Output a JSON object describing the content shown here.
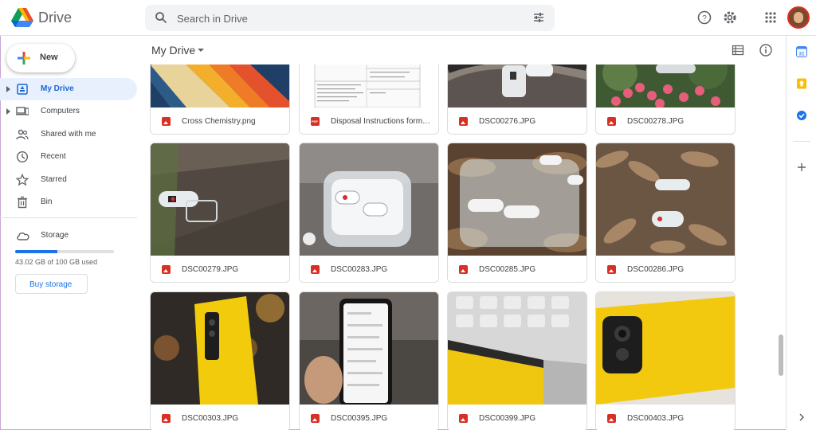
{
  "app": {
    "brand": "Drive"
  },
  "search": {
    "placeholder": "Search in Drive"
  },
  "sidebar": {
    "new_label": "New",
    "items": [
      {
        "label": "My Drive",
        "icon": "my-drive-icon",
        "active": true,
        "expandable": true
      },
      {
        "label": "Computers",
        "icon": "computer-icon",
        "active": false,
        "expandable": true
      },
      {
        "label": "Shared with me",
        "icon": "people-icon",
        "active": false,
        "expandable": false
      },
      {
        "label": "Recent",
        "icon": "clock-icon",
        "active": false,
        "expandable": false
      },
      {
        "label": "Starred",
        "icon": "star-icon",
        "active": false,
        "expandable": false
      },
      {
        "label": "Bin",
        "icon": "trash-icon",
        "active": false,
        "expandable": false
      }
    ],
    "storage_label": "Storage",
    "storage_used_text": "43.02 GB of 100 GB used",
    "storage_fraction": 0.43,
    "buy_label": "Buy storage"
  },
  "main": {
    "breadcrumb": "My Drive"
  },
  "files": [
    {
      "name": "Cross Chemistry.png",
      "type": "image"
    },
    {
      "name": "Disposal Instructions format...",
      "type": "pdf"
    },
    {
      "name": "DSC00276.JPG",
      "type": "image"
    },
    {
      "name": "DSC00278.JPG",
      "type": "image"
    },
    {
      "name": "DSC00279.JPG",
      "type": "image"
    },
    {
      "name": "DSC00283.JPG",
      "type": "image"
    },
    {
      "name": "DSC00285.JPG",
      "type": "image"
    },
    {
      "name": "DSC00286.JPG",
      "type": "image"
    },
    {
      "name": "DSC00303.JPG",
      "type": "image"
    },
    {
      "name": "DSC00395.JPG",
      "type": "image"
    },
    {
      "name": "DSC00399.JPG",
      "type": "image"
    },
    {
      "name": "DSC00403.JPG",
      "type": "image"
    }
  ],
  "colors": {
    "accent": "#1a73e8",
    "active_bg": "#e8f0fe",
    "file_icon": "#d93025"
  }
}
